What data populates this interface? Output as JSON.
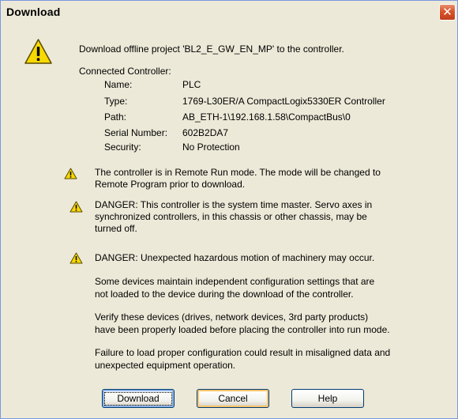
{
  "window": {
    "title": "Download",
    "close_symbol": "✕"
  },
  "message": {
    "intro": "Download offline project 'BL2_E_GW_EN_MP' to the controller.",
    "connected_heading": "Connected Controller:"
  },
  "controller": {
    "name_label": "Name:",
    "name_value": "PLC",
    "type_label": "Type:",
    "type_value": "1769-L30ER/A CompactLogix5330ER Controller",
    "path_label": "Path:",
    "path_value": "AB_ETH-1\\192.168.1.58\\CompactBus\\0",
    "serial_label": "Serial Number:",
    "serial_value": "602B2DA7",
    "security_label": "Security:",
    "security_value": "No Protection"
  },
  "warnings": {
    "w1_line1": "The controller is in Remote Run mode. The mode will be changed to",
    "w1_line2": "Remote Program prior to download.",
    "w2_line1": "DANGER: This controller is the system time master.  Servo axes in",
    "w2_line2": "synchronized controllers, in this chassis or other chassis, may be",
    "w2_line3": "turned off.",
    "w3_line1": "DANGER: Unexpected hazardous motion of machinery may occur."
  },
  "notes": {
    "p1_line1": "Some devices maintain independent configuration settings that are",
    "p1_line2": "not loaded to the device during the download of the controller.",
    "p2_line1": "Verify these devices (drives, network devices, 3rd party products)",
    "p2_line2": "have been properly loaded before placing the controller into run mode.",
    "p3_line1": "Failure to load proper configuration could result in misaligned data and",
    "p3_line2": "unexpected equipment operation."
  },
  "buttons": {
    "download": "Download",
    "cancel": "Cancel",
    "help": "Help"
  },
  "icons": {
    "large_warning": "warning-triangle-icon",
    "small_warning": "warning-triangle-icon"
  },
  "colors": {
    "dialog_bg": "#ece9d8",
    "warning_yellow": "#f5d400",
    "close_red": "#d9542c"
  }
}
